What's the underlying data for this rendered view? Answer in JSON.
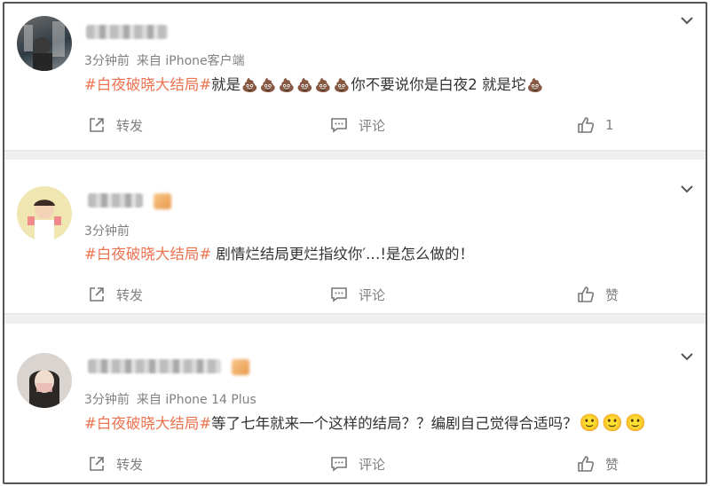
{
  "posts": [
    {
      "time": "3分钟前",
      "source": "来自 iPhone客户端",
      "hashtag": "#白夜破晓大结局#",
      "text_before": "就是",
      "text_after": "你不要说你是白夜2 就是坨",
      "actions": {
        "share": "转发",
        "comment": "评论",
        "like": "1"
      }
    },
    {
      "time": "3分钟前",
      "source": "",
      "hashtag": "#白夜破晓大结局#",
      "text": " 剧情烂结局更烂指纹你′.‥!是怎么做的！",
      "actions": {
        "share": "转发",
        "comment": "评论",
        "like": "赞"
      }
    },
    {
      "time": "3分钟前",
      "source": "来自 iPhone 14 Plus",
      "hashtag": "#白夜破晓大结局#",
      "text": "等了七年就来一个这样的结局？？编剧自己觉得合适吗？",
      "actions": {
        "share": "转发",
        "comment": "评论",
        "like": "赞"
      }
    }
  ],
  "icons": {
    "poop": "💩",
    "smile": "🙂",
    "expand": "chevron-down-icon",
    "share": "share-icon",
    "comment": "comment-icon",
    "like": "thumbs-up-icon"
  },
  "colors": {
    "hashtag": "#eb7350",
    "meta": "#808080",
    "text": "#333333",
    "separator": "#f0f0f0"
  }
}
